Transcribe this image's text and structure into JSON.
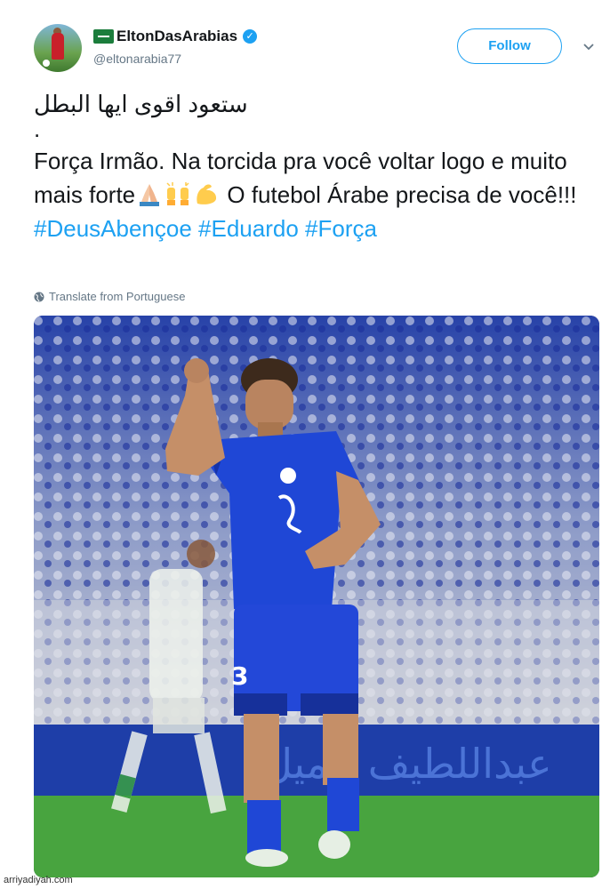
{
  "user": {
    "display_name": "EltonDasArabias",
    "handle": "@eltonarabia77",
    "verified_icon": "verified-badge-icon",
    "flag_icon": "saudi-flag-icon"
  },
  "follow_button": {
    "label": "Follow"
  },
  "tweet": {
    "arabic_line": "ستعود اقوى ايها البطل",
    "dot_line": ".",
    "text_part1": "Força Irmão. Na torcida pra você voltar logo e muito mais forte",
    "text_part2": " O futebol Árabe precisa de você!!! ",
    "hashtags": [
      "#DeusAbençoe",
      "#Eduardo",
      "#Força"
    ],
    "emojis": [
      "praying-hands-icon",
      "raising-hands-icon",
      "flexed-biceps-icon"
    ]
  },
  "translate": {
    "label": "Translate from Portuguese"
  },
  "photo": {
    "player_number": "3",
    "ad_text": "عبداللطيف جميل"
  },
  "watermark": "arriyadiyah.com",
  "colors": {
    "accent": "#1da1f2",
    "text": "#14171a",
    "muted": "#657786"
  }
}
